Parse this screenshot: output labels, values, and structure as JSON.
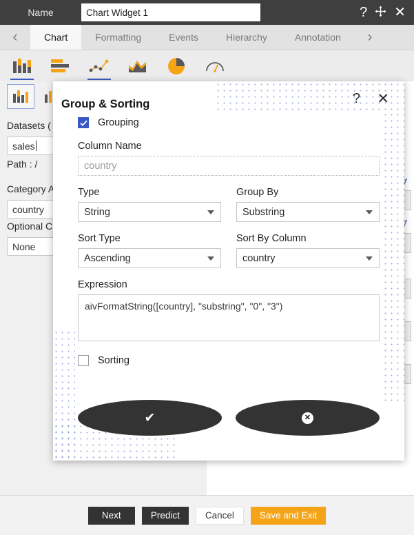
{
  "titlebar": {
    "name_label": "Name",
    "widget_name": "Chart Widget 1",
    "help_icon": "question-mark-icon",
    "move_icon": "move-arrows-icon",
    "close_icon": "close-icon",
    "close_glyph": "✕",
    "help_glyph": "?"
  },
  "tabs": {
    "prev_glyph": "‹",
    "next_glyph": "›",
    "items": [
      {
        "label": "Chart",
        "active": true
      },
      {
        "label": "Formatting",
        "active": false
      },
      {
        "label": "Events",
        "active": false
      },
      {
        "label": "Hierarchy",
        "active": false
      },
      {
        "label": "Annotation",
        "active": false
      }
    ]
  },
  "chart_types": [
    {
      "name": "column-chart-icon",
      "selected": true
    },
    {
      "name": "bar-chart-icon",
      "selected": false
    },
    {
      "name": "scatter-line-chart-icon",
      "selected": true
    },
    {
      "name": "area-chart-icon",
      "selected": false
    },
    {
      "name": "pie-chart-icon",
      "selected": false
    },
    {
      "name": "gauge-chart-icon",
      "selected": false
    }
  ],
  "left_panel": {
    "datasets_label": "Datasets (",
    "datasets_value": "sales",
    "path_label": "Path :  /",
    "category_label": "Category A",
    "category_value": "country",
    "optional_label": "Optional C",
    "optional_value": "None"
  },
  "right_column": {
    "paren": ")",
    "cursor_icon": "pointer-arrow-icon",
    "chevron_icon": "chevron-down-icon",
    "chevron_glyph": "⌄"
  },
  "modal": {
    "title": "Group & Sorting",
    "help_glyph": "?",
    "close_glyph": "✕",
    "grouping": {
      "label": "Grouping",
      "checked": true
    },
    "column_name": {
      "label": "Column Name",
      "value": "country"
    },
    "type": {
      "label": "Type",
      "value": "String"
    },
    "group_by": {
      "label": "Group By",
      "value": "Substring"
    },
    "sort_type": {
      "label": "Sort Type",
      "value": "Ascending"
    },
    "sort_by_column": {
      "label": "Sort By Column",
      "value": "country"
    },
    "expression": {
      "label": "Expression",
      "value": "aivFormatString([country], \"substring\", \"0\", \"3\")"
    },
    "sorting": {
      "label": "Sorting",
      "checked": false
    },
    "confirm": {
      "name": "confirm-button",
      "glyph": "✔"
    },
    "cancel": {
      "name": "cancel-button",
      "glyph": "✕"
    }
  },
  "bottombar": {
    "next": "Next",
    "predict": "Predict",
    "cancel": "Cancel",
    "save_and_exit": "Save and Exit"
  },
  "colors": {
    "accent_orange": "#f5a417",
    "titlebar_dark": "#3f3f3f",
    "checkbox_blue": "#3a55c4",
    "tab_underline_blue": "#3b5bbf",
    "dot_pattern_blue": "#7f93d6"
  }
}
